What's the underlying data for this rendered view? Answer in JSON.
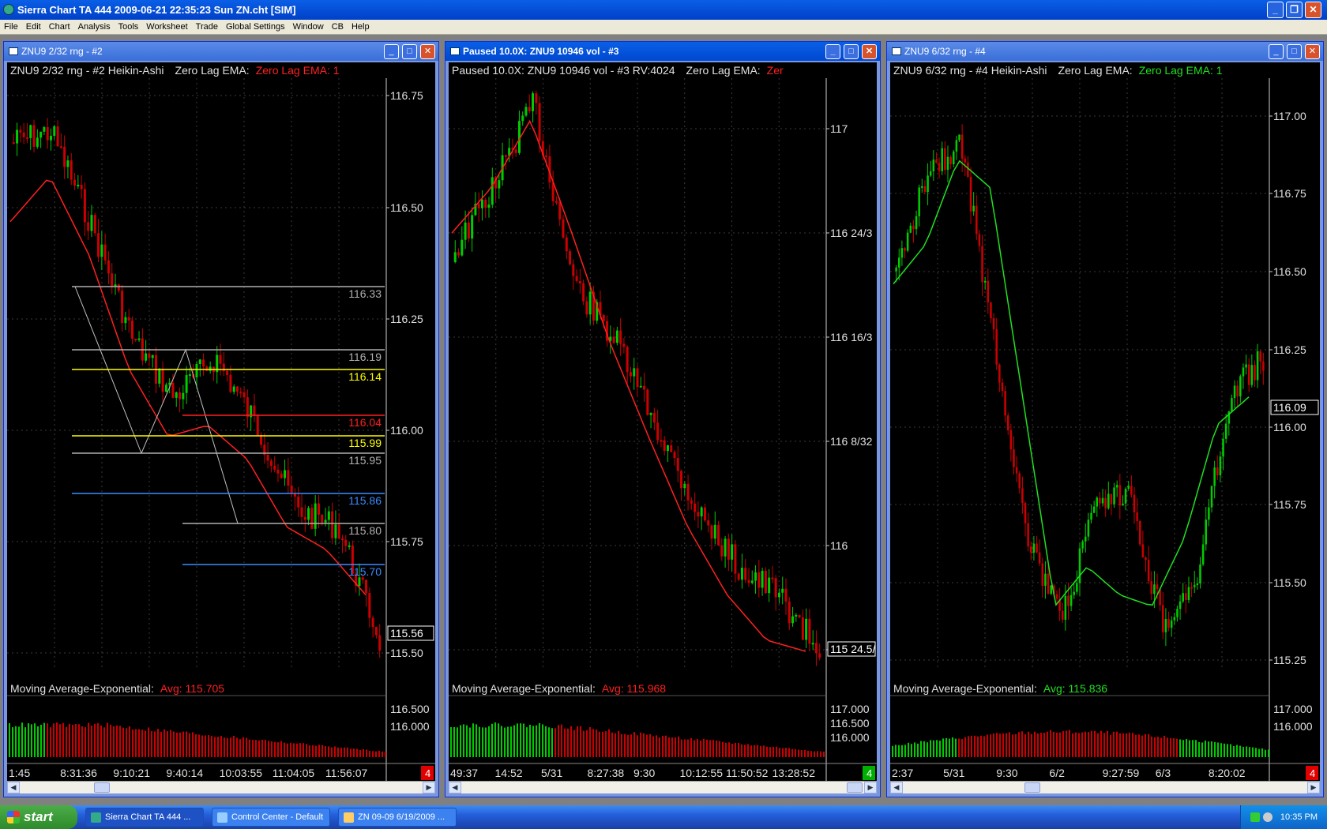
{
  "app": {
    "title": "Sierra Chart TA 444   2009-06-21   22:35:23  Sun   ZN.cht [SIM]"
  },
  "menu": [
    "File",
    "Edit",
    "Chart",
    "Analysis",
    "Tools",
    "Worksheet",
    "Trade",
    "Global Settings",
    "Window",
    "CB",
    "Help"
  ],
  "colors": {
    "bull": "#00cc00",
    "bear": "#cc0000",
    "ema_red": "#ff2020",
    "ema_green": "#20e020",
    "grid": "#333333"
  },
  "charts": [
    {
      "window_title": "ZNU9  2/32 rng - #2",
      "active": false,
      "header": {
        "study": "ZNU9  2/32 rng - #2 Heikin-Ashi",
        "ema_label": "Zero Lag EMA:",
        "ema_value": "Zero Lag EMA: 1"
      },
      "y_labels": [
        "116.75",
        "116.50",
        "116.25",
        "116.00",
        "115.75",
        "115.50"
      ],
      "price_box": "115.56",
      "levels": [
        {
          "text": "116.33",
          "color": "#b0b0b0"
        },
        {
          "text": "116.19",
          "color": "#b0b0b0"
        },
        {
          "text": "116.14",
          "color": "#ffff00"
        },
        {
          "text": "116.04",
          "color": "#ff2020"
        },
        {
          "text": "115.99",
          "color": "#ffff00"
        },
        {
          "text": "115.95",
          "color": "#b0b0b0"
        },
        {
          "text": "115.86",
          "color": "#3a8cff"
        },
        {
          "text": "115.80",
          "color": "#b0b0b0"
        },
        {
          "text": "115.70",
          "color": "#3a8cff"
        }
      ],
      "ma_label": "Moving Average-Exponential:",
      "ma_value": "Avg: 115.705",
      "ma_color": "#ff2020",
      "sub_y_labels": [
        "116.500",
        "116.000"
      ],
      "x_labels": [
        "1:45",
        "8:31:36",
        "9:10:21",
        "9:40:14",
        "10:03:55",
        "11:04:05",
        "11:56:07"
      ],
      "badge": "4",
      "badge_color": "#e00000"
    },
    {
      "window_title": "Paused 10.0X: ZNU9  10946 vol - #3",
      "active": true,
      "header": {
        "study": "Paused 10.0X: ZNU9  10946 vol - #3  RV:4024",
        "ema_label": "Zero Lag EMA:",
        "ema_value": "Zer"
      },
      "y_labels": [
        "117",
        "116 24/3",
        "116 16/3",
        "116 8/32",
        "116",
        "115 24/3"
      ],
      "price_box": "115 24.5/",
      "levels": [],
      "ma_label": "Moving Average-Exponential:",
      "ma_value": "Avg: 115.968",
      "ma_color": "#ff2020",
      "sub_y_labels": [
        "117.000",
        "116.500",
        "116.000"
      ],
      "x_labels": [
        "49:37",
        "14:52",
        "5/31",
        "8:27:38",
        "9:30",
        "10:12:55",
        "11:50:52",
        "13:28:52"
      ],
      "badge": "4",
      "badge_color": "#00b000"
    },
    {
      "window_title": "ZNU9  6/32 rng - #4",
      "active": false,
      "header": {
        "study": "ZNU9  6/32 rng - #4 Heikin-Ashi",
        "ema_label": "Zero Lag EMA:",
        "ema_value": "Zero Lag EMA: 1"
      },
      "y_labels": [
        "117.00",
        "116.75",
        "116.50",
        "116.25",
        "116.00",
        "115.75",
        "115.50",
        "115.25"
      ],
      "price_box": "116.09",
      "levels": [],
      "ma_label": "Moving Average-Exponential:",
      "ma_value": "Avg: 115.836",
      "ma_color": "#20e020",
      "sub_y_labels": [
        "117.000",
        "116.000"
      ],
      "x_labels": [
        "2:37",
        "5/31",
        "9:30",
        "6/2",
        "9:27:59",
        "6/3",
        "8:20:02"
      ],
      "badge": "4",
      "badge_color": "#e00000"
    }
  ],
  "taskbar": {
    "start": "start",
    "items": [
      "Sierra Chart TA 444 ...",
      "Control Center - Default",
      "ZN 09-09  6/19/2009 ..."
    ],
    "clock": "10:35 PM"
  }
}
